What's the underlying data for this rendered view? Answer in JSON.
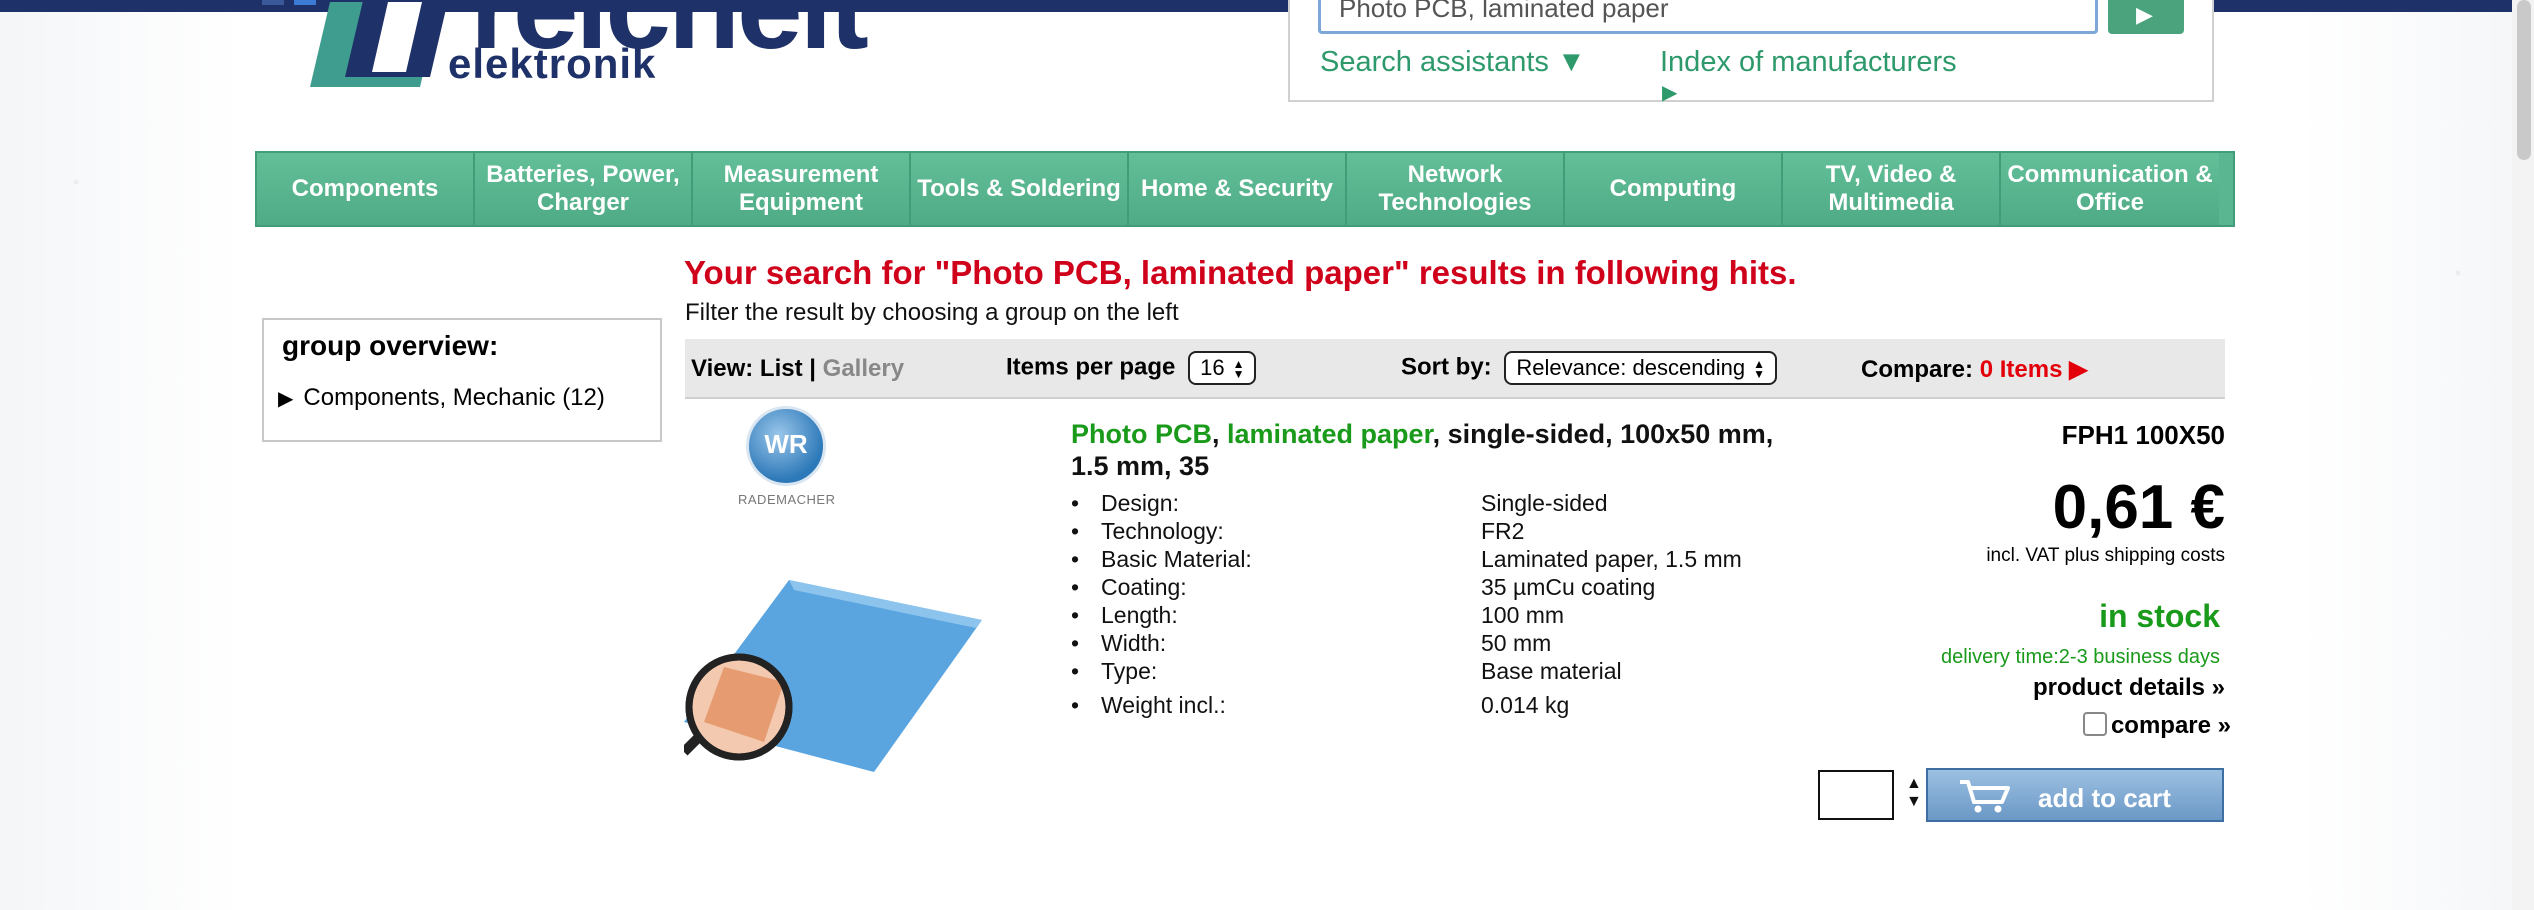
{
  "brand": {
    "logo_word": "reichelt",
    "logo_sub": "elektronik"
  },
  "search": {
    "value": "Photo PCB, laminated paper",
    "assistants": "Search assistants ▼",
    "manufacturers": "Index of manufacturers",
    "manufacturers_arrow": "▶"
  },
  "nav": {
    "items": [
      {
        "label": "Components"
      },
      {
        "label": "Batteries, Power, Charger"
      },
      {
        "label": "Measurement Equipment"
      },
      {
        "label": "Tools & Soldering"
      },
      {
        "label": "Home & Security"
      },
      {
        "label": "Network Technologies"
      },
      {
        "label": "Computing"
      },
      {
        "label": "TV, Video & Multimedia"
      },
      {
        "label": "Communication & Office"
      }
    ]
  },
  "results": {
    "headline": "Your search for \"Photo PCB, laminated paper\" results in following hits.",
    "subline": "Filter the result by choosing a group on the left"
  },
  "groups": {
    "title": "group overview:",
    "item_marker": "▶",
    "item": "Components, Mechanic (12)"
  },
  "toolbar": {
    "view_label": "View:",
    "view_list": "List",
    "separator": "|",
    "view_gallery": "Gallery",
    "items_label": "Items per page",
    "items_value": "16",
    "sort_label": "Sort by:",
    "sort_value": "Relevance: descending",
    "compare_label": "Compare:",
    "compare_count": "0 Items ▶"
  },
  "product": {
    "brand_name": "RADEMACHER",
    "title_hl1": "Photo PCB",
    "title_sep": ", ",
    "title_hl2": "laminated paper",
    "title_rest": ", single-sided, 100x50 mm, 1.5 mm, 35",
    "specs": [
      {
        "label": "Design:",
        "value": "Single-sided"
      },
      {
        "label": "Technology:",
        "value": "FR2"
      },
      {
        "label": "Basic Material:",
        "value": "Laminated paper, 1.5 mm"
      },
      {
        "label": "Coating:",
        "value": "35 µmCu coating"
      },
      {
        "label": "Length:",
        "value": "100 mm"
      },
      {
        "label": "Width:",
        "value": "50 mm"
      },
      {
        "label": "Type:",
        "value": "Base material"
      },
      {
        "label": "Weight incl.:",
        "value": "0.014 kg"
      }
    ],
    "bullet": "•",
    "sku": "FPH1 100X50",
    "price": "0,61 €",
    "vat": "incl. VAT plus shipping costs",
    "stock": "in stock",
    "delivery": "delivery time:2-3 business days",
    "details": "product details »",
    "compare": "compare »",
    "cart": "add to cart"
  },
  "colors": {
    "nav_green": "#5ab690",
    "headline_red": "#d0021b",
    "stock_green": "#1a9a1a",
    "brand_blue": "#1e3168"
  }
}
